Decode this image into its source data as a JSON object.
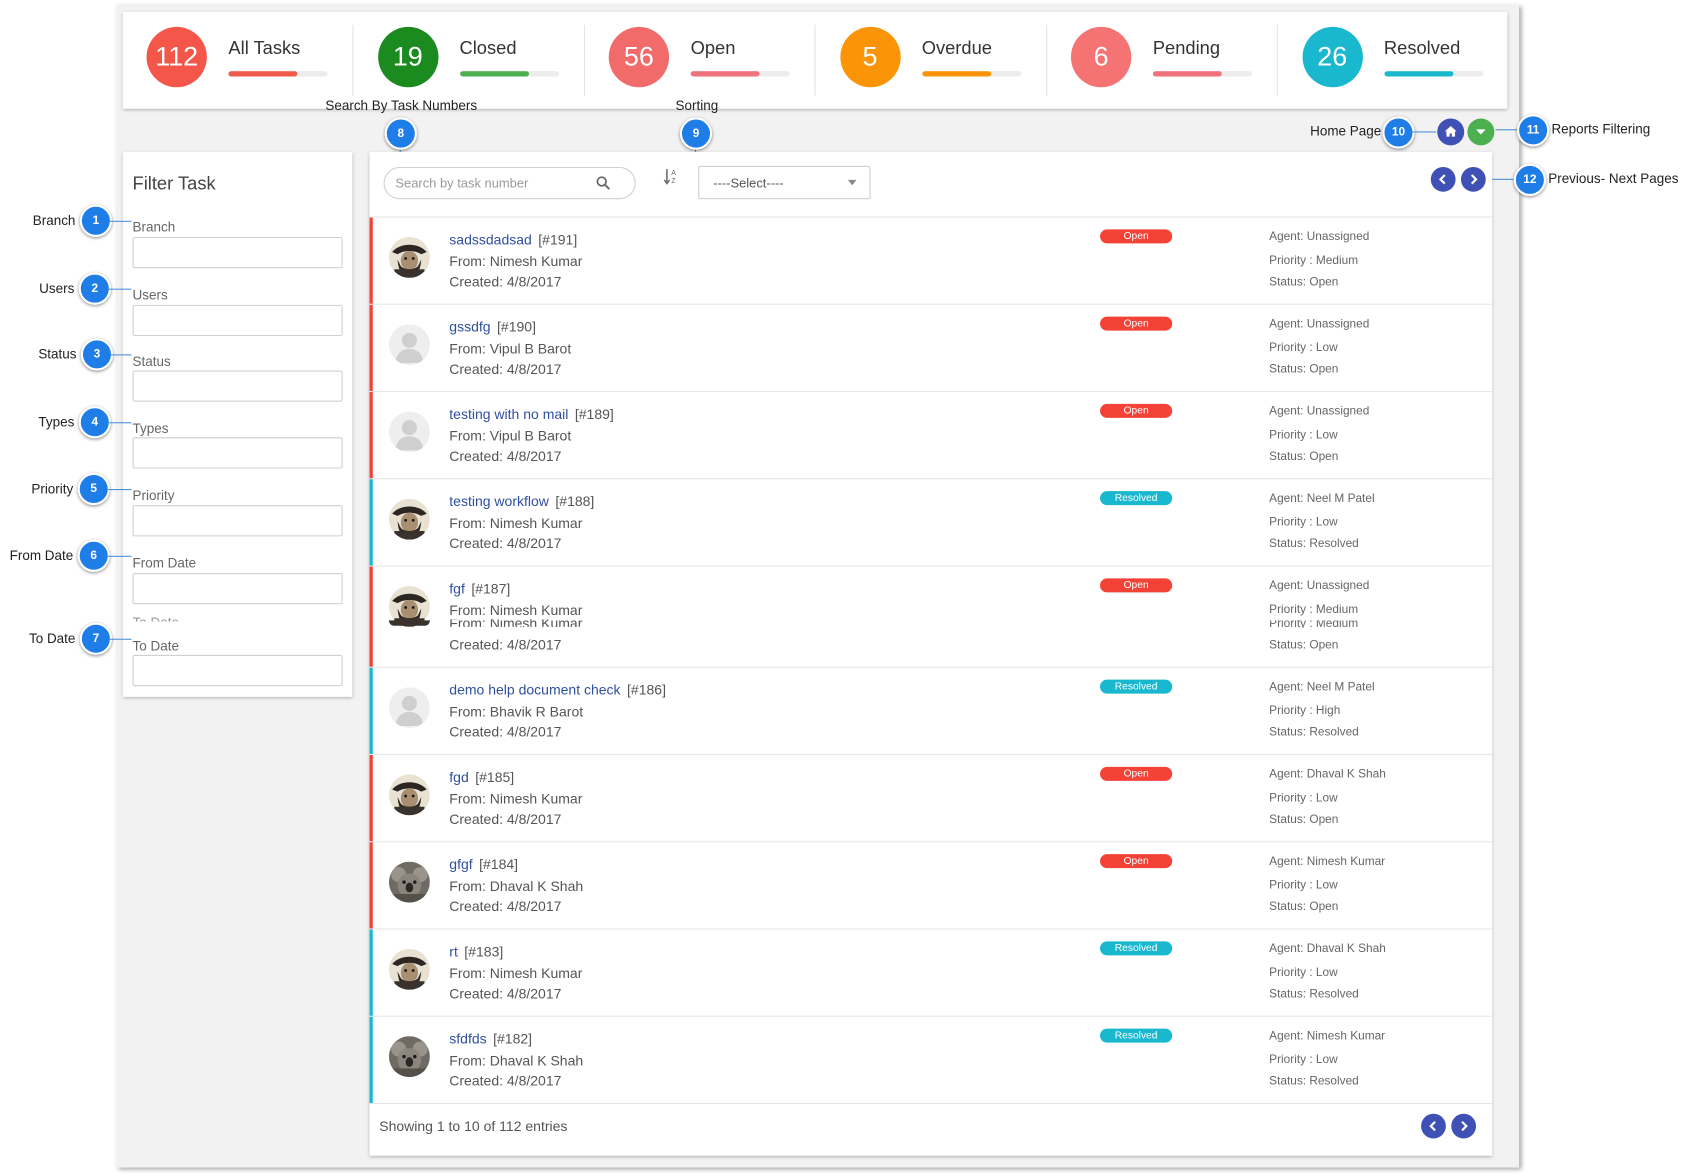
{
  "stats": [
    {
      "value": "112",
      "label": "All Tasks",
      "color": "#f4574a",
      "bar": "#ef5b4b",
      "progress": 0.7
    },
    {
      "value": "19",
      "label": "Closed",
      "color": "#1b8a1f",
      "bar": "#4caf50",
      "progress": 0.7
    },
    {
      "value": "56",
      "label": "Open",
      "color": "#f26b6b",
      "bar": "#f0727a",
      "progress": 0.7
    },
    {
      "value": "5",
      "label": "Overdue",
      "color": "#fb9407",
      "bar": "#fb9407",
      "progress": 0.7
    },
    {
      "value": "6",
      "label": "Pending",
      "color": "#f57373",
      "bar": "#f0727a",
      "progress": 0.7
    },
    {
      "value": "26",
      "label": "Resolved",
      "color": "#19b8cf",
      "bar": "#19b8cf",
      "progress": 0.7
    }
  ],
  "annotations": {
    "search": {
      "label": "Search By Task Numbers",
      "num": "8"
    },
    "sorting": {
      "label": "Sorting",
      "num": "9"
    },
    "home": {
      "label": "Home Page",
      "num": "10"
    },
    "reports": {
      "label": "Reports Filtering",
      "num": "11"
    },
    "pages": {
      "label": "Previous- Next Pages",
      "num": "12"
    },
    "filters": [
      {
        "label": "Branch",
        "num": "1"
      },
      {
        "label": "Users",
        "num": "2"
      },
      {
        "label": "Status",
        "num": "3"
      },
      {
        "label": "Types",
        "num": "4"
      },
      {
        "label": "Priority",
        "num": "5"
      },
      {
        "label": "From Date",
        "num": "6"
      },
      {
        "label": "To Date",
        "num": "7"
      }
    ]
  },
  "filter": {
    "title": "Filter Task",
    "fields": [
      "Branch",
      "Users",
      "Status",
      "Types",
      "Priority",
      "From Date",
      "To Date"
    ]
  },
  "toolbar": {
    "search_placeholder": "Search by task number",
    "sort_glyph": "↓ᴬᴢ",
    "select_value": "----Select----"
  },
  "tasks": [
    {
      "title": "sadssdadsad",
      "num": "[#191]",
      "from": "From: Nimesh Kumar",
      "created": "Created: 4/8/2017",
      "status_pill": "Open",
      "agent": "Agent: Unassigned",
      "priority": "Priority : Medium",
      "status": "Status: Open",
      "avatar": "pirate"
    },
    {
      "title": "gssdfg",
      "num": "[#190]",
      "from": "From: Vipul B Barot",
      "created": "Created: 4/8/2017",
      "status_pill": "Open",
      "agent": "Agent: Unassigned",
      "priority": "Priority : Low",
      "status": "Status: Open",
      "avatar": "blank"
    },
    {
      "title": "testing with no mail",
      "num": "[#189]",
      "from": "From: Vipul B Barot",
      "created": "Created: 4/8/2017",
      "status_pill": "Open",
      "agent": "Agent: Unassigned",
      "priority": "Priority : Low",
      "status": "Status: Open",
      "avatar": "blank"
    },
    {
      "title": "testing workflow",
      "num": "[#188]",
      "from": "From: Nimesh Kumar",
      "created": "Created: 4/8/2017",
      "status_pill": "Resolved",
      "agent": "Agent: Neel M Patel",
      "priority": "Priority : Low",
      "status": "Status: Resolved",
      "avatar": "pirate"
    },
    {
      "title": "fgf",
      "num": "[#187]",
      "from": "From: Nimesh Kumar",
      "created": "Created: 4/8/2017",
      "status_pill": "Open",
      "agent": "Agent: Unassigned",
      "priority": "Priority : Medium",
      "status": "Status: Open",
      "avatar": "pirate"
    },
    {
      "title": "demo help document check",
      "num": "[#186]",
      "from": "From: Bhavik R Barot",
      "created": "Created: 4/8/2017",
      "status_pill": "Resolved",
      "agent": "Agent: Neel M Patel",
      "priority": "Priority : High",
      "status": "Status: Resolved",
      "avatar": "blank"
    },
    {
      "title": "fgd",
      "num": "[#185]",
      "from": "From: Nimesh Kumar",
      "created": "Created: 4/8/2017",
      "status_pill": "Open",
      "agent": "Agent: Dhaval K Shah",
      "priority": "Priority : Low",
      "status": "Status: Open",
      "avatar": "pirate"
    },
    {
      "title": "gfgf",
      "num": "[#184]",
      "from": "From: Dhaval K Shah",
      "created": "Created: 4/8/2017",
      "status_pill": "Open",
      "agent": "Agent: Nimesh Kumar",
      "priority": "Priority : Low",
      "status": "Status: Open",
      "avatar": "koala"
    },
    {
      "title": "rt",
      "num": "[#183]",
      "from": "From: Nimesh Kumar",
      "created": "Created: 4/8/2017",
      "status_pill": "Resolved",
      "agent": "Agent: Dhaval K Shah",
      "priority": "Priority : Low",
      "status": "Status: Resolved",
      "avatar": "pirate"
    },
    {
      "title": "sfdfds",
      "num": "[#182]",
      "from": "From: Dhaval K Shah",
      "created": "Created: 4/8/2017",
      "status_pill": "Resolved",
      "agent": "Agent: Nimesh Kumar",
      "priority": "Priority : Low",
      "status": "Status: Resolved",
      "avatar": "koala"
    }
  ],
  "footer": {
    "showing": "Showing 1 to 10 of 112 entries"
  },
  "colors": {
    "open": "#f44336",
    "resolved": "#19b8cf",
    "nav": "#3f51b5",
    "home": "#3f51b5",
    "reports": "#4caf50",
    "badge": "#1f7de8"
  },
  "icons": {
    "search": "search-icon",
    "home": "home-icon",
    "reports": "caret-down-icon",
    "prev": "chevron-left-icon",
    "next": "chevron-right-icon",
    "sort": "sort-alpha-icon"
  }
}
